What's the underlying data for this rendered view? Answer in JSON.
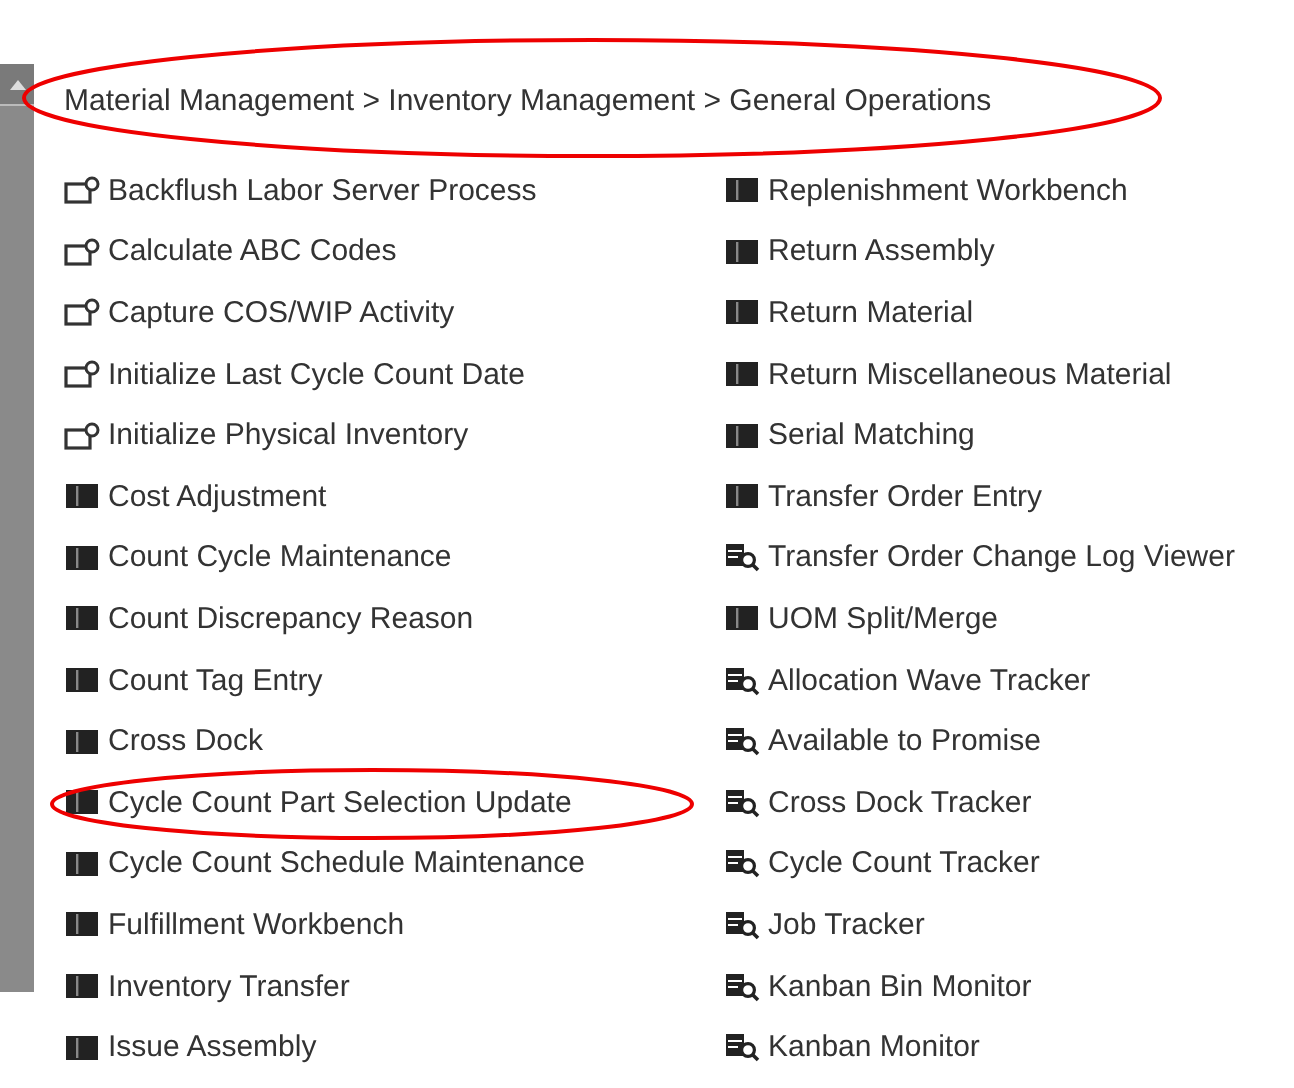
{
  "breadcrumb": "Material Management > Inventory Management > General Operations",
  "columns": [
    [
      {
        "label": "Backflush Labor Server Process",
        "kind": "process"
      },
      {
        "label": "Calculate ABC Codes",
        "kind": "process"
      },
      {
        "label": "Capture COS/WIP Activity",
        "kind": "process"
      },
      {
        "label": "Initialize Last Cycle Count Date",
        "kind": "process"
      },
      {
        "label": "Initialize Physical Inventory",
        "kind": "process"
      },
      {
        "label": "Cost Adjustment",
        "kind": "entry"
      },
      {
        "label": "Count Cycle Maintenance",
        "kind": "entry"
      },
      {
        "label": "Count Discrepancy Reason",
        "kind": "entry"
      },
      {
        "label": "Count Tag Entry",
        "kind": "entry"
      },
      {
        "label": "Cross Dock",
        "kind": "entry"
      },
      {
        "label": "Cycle Count Part Selection Update",
        "kind": "entry"
      },
      {
        "label": "Cycle Count Schedule Maintenance",
        "kind": "entry"
      },
      {
        "label": "Fulfillment Workbench",
        "kind": "entry"
      },
      {
        "label": "Inventory Transfer",
        "kind": "entry"
      },
      {
        "label": "Issue Assembly",
        "kind": "entry"
      }
    ],
    [
      {
        "label": "Replenishment Workbench",
        "kind": "entry"
      },
      {
        "label": "Return Assembly",
        "kind": "entry"
      },
      {
        "label": "Return Material",
        "kind": "entry"
      },
      {
        "label": "Return Miscellaneous Material",
        "kind": "entry"
      },
      {
        "label": "Serial Matching",
        "kind": "entry"
      },
      {
        "label": "Transfer Order Entry",
        "kind": "entry"
      },
      {
        "label": "Transfer Order Change Log Viewer",
        "kind": "tracker"
      },
      {
        "label": "UOM Split/Merge",
        "kind": "entry"
      },
      {
        "label": "Allocation Wave Tracker",
        "kind": "tracker"
      },
      {
        "label": "Available to Promise",
        "kind": "tracker"
      },
      {
        "label": "Cross Dock Tracker",
        "kind": "tracker"
      },
      {
        "label": "Cycle Count Tracker",
        "kind": "tracker"
      },
      {
        "label": "Job Tracker",
        "kind": "tracker"
      },
      {
        "label": "Kanban Bin Monitor",
        "kind": "tracker"
      },
      {
        "label": "Kanban Monitor",
        "kind": "tracker"
      }
    ]
  ]
}
